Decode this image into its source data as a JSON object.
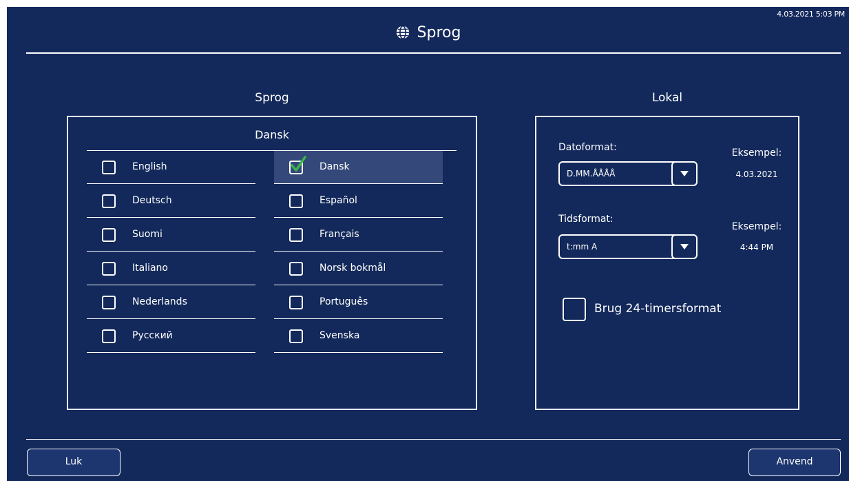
{
  "header": {
    "title": "Sprog",
    "timestamp": "4.03.2021 5:03 PM",
    "icon": "globe-icon"
  },
  "language_section": {
    "heading": "Sprog",
    "current": "Dansk",
    "left_column": [
      "English",
      "Deutsch",
      "Suomi",
      "Italiano",
      "Nederlands",
      "Русский"
    ],
    "right_column": [
      "Dansk",
      "Español",
      "Français",
      "Norsk bokmål",
      "Português",
      "Svenska"
    ],
    "selected": "Dansk"
  },
  "locale_section": {
    "heading": "Lokal",
    "date_format": {
      "label": "Datoformat:",
      "value": "D.MM.ÅÅÅÅ",
      "example_label": "Eksempel:",
      "example_value": "4.03.2021"
    },
    "time_format": {
      "label": "Tidsformat:",
      "value": "t:mm A",
      "example_label": "Eksempel:",
      "example_value": "4:44 PM"
    },
    "use_24h": {
      "label": "Brug 24-timersformat",
      "checked": false
    }
  },
  "footer": {
    "close_label": "Luk",
    "apply_label": "Anvend"
  },
  "colors": {
    "background": "#13295b",
    "selected_row": "#34497a",
    "check": "#3bb54a"
  }
}
